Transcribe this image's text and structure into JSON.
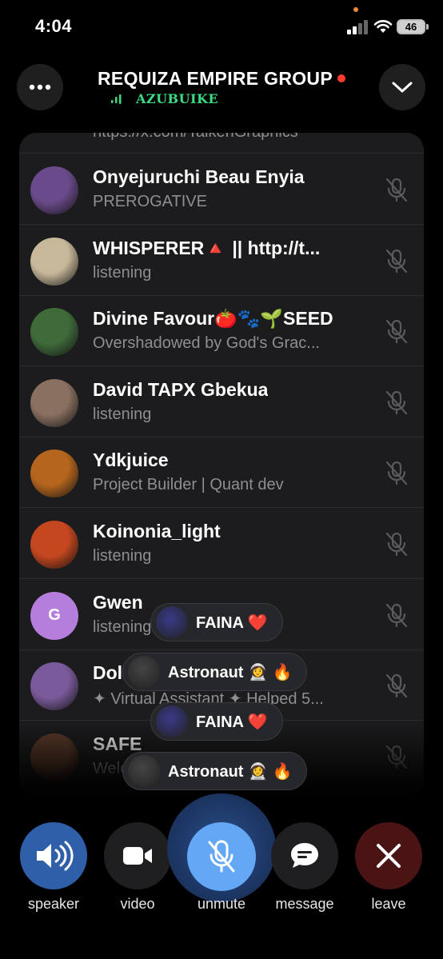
{
  "status": {
    "time": "4:04",
    "battery": "46"
  },
  "header": {
    "title": "REQUIZA EMPIRE GROUP",
    "speaking_name": "AZUBUIKE"
  },
  "partial_row_text": "https://x.com/TalkenGraphics",
  "participants": [
    {
      "name": "Onyejuruchi Beau Enyia",
      "status": "PREROGATIVE",
      "avatar_color": "#6a4a8a"
    },
    {
      "name": "WHISPERER🔺 || http://t...",
      "status": "listening",
      "avatar_color": "#c8b89a"
    },
    {
      "name": "Divine Favour🍅🐾🌱SEED",
      "status": "Overshadowed by God's Grac...",
      "avatar_color": "#3f6b3a"
    },
    {
      "name": "David TAPX Gbekua",
      "status": "listening",
      "avatar_color": "#8a7060"
    },
    {
      "name": "Ydkjuice",
      "status": "Project Builder | Quant dev",
      "avatar_color": "#b5651d"
    },
    {
      "name": "Koinonia_light",
      "status": "listening",
      "avatar_color": "#c4471f"
    },
    {
      "name": "Gwen",
      "status": "listening",
      "avatar_initial": "G",
      "avatar_color": "#b57edc"
    },
    {
      "name": "Dolly",
      "status": "✦ Virtual Assistant ✦ Helped 5...",
      "avatar_color": "#7a5a9a"
    },
    {
      "name": "SAFE",
      "status": "Welcome to SAFE DAO...",
      "avatar_color": "#5a3a2a"
    }
  ],
  "reactions": [
    {
      "label": "FAINA ❤️",
      "avatar_color": "#3a3a8a"
    },
    {
      "label": "Astronaut 👩‍🚀 🔥",
      "avatar_color": "#444"
    },
    {
      "label": "FAINA ❤️",
      "avatar_color": "#3a3a8a"
    },
    {
      "label": "Astronaut 👩‍🚀 🔥",
      "avatar_color": "#444"
    }
  ],
  "controls": {
    "speaker": "speaker",
    "video": "video",
    "unmute": "unmute",
    "message": "message",
    "leave": "leave"
  },
  "colors": {
    "accent": "#63a7f5",
    "live": "#ff3b30",
    "speaking": "#3ddc84",
    "leave": "#4a1414"
  }
}
